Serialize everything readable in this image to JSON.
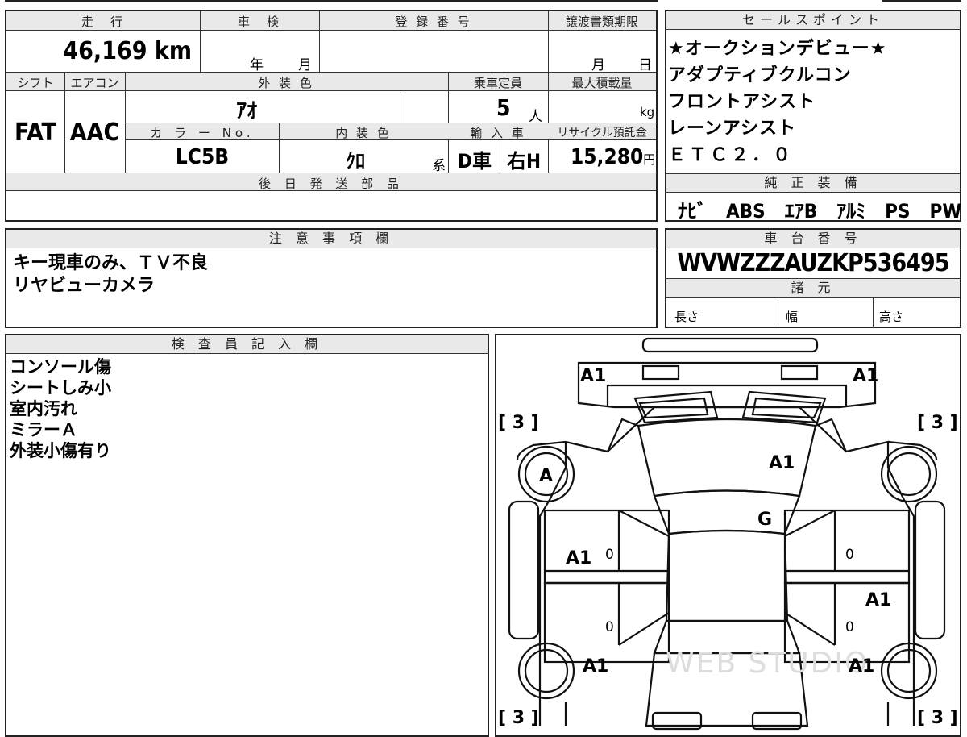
{
  "sheet": {
    "mileage": {
      "label": "走　行",
      "value": "46,169",
      "unit": "km"
    },
    "inspection": {
      "label": "車　検",
      "year_label": "年",
      "month_label": "月"
    },
    "registration": {
      "label": "登 録 番 号"
    },
    "transfer_deadline": {
      "label": "譲渡書類期限",
      "month_label": "月",
      "day_label": "日"
    },
    "shift": {
      "label": "シフト",
      "value": "FAT"
    },
    "aircon": {
      "label": "エアコン",
      "value": "AAC"
    },
    "exterior_color": {
      "label": "外 装 色",
      "value": "ｱｵ"
    },
    "capacity": {
      "label": "乗車定員",
      "value": "5",
      "unit": "人"
    },
    "max_load": {
      "label": "最大積載量",
      "unit": "kg"
    },
    "color_no": {
      "label": "カ ラ ー No.",
      "value": "LC5B"
    },
    "interior_color": {
      "label": "内 装 色",
      "value": "ｸﾛ",
      "suffix": "系"
    },
    "import": {
      "label": "輸 入 車",
      "value1": "D車",
      "value2": "右H"
    },
    "recycle": {
      "label": "リサイクル預託金",
      "value": "15,280",
      "unit": "円"
    },
    "later_parts": {
      "label": "後 日 発 送 部 品"
    }
  },
  "sales_points": {
    "label": "セールスポイント",
    "lines": [
      "★オークションデビュー★",
      "アダプティブクルコン",
      "フロントアシスト",
      "レーンアシスト",
      "ＥＴＣ２．０"
    ]
  },
  "genuine_equipment": {
    "label": "純 正 装 備",
    "value": "ﾅﾋﾞ　ABS　ｴｱB　ｱﾙﾐ　PS　PW"
  },
  "caution": {
    "label": "注 意 事 項 欄",
    "lines": [
      "キー現車のみ、ＴＶ不良",
      "リヤビューカメラ"
    ]
  },
  "chassis": {
    "label": "車 台 番 号",
    "value": "WVWZZZAUZKP536495"
  },
  "specs": {
    "label": "諸 元",
    "length_label": "長さ",
    "width_label": "幅",
    "height_label": "高さ"
  },
  "inspector": {
    "label": "検 査 員 記 入 欄",
    "lines": [
      "コンソール傷",
      "シートしみ小",
      "室内汚れ",
      "ミラーＡ",
      "外装小傷有り"
    ]
  },
  "diagram": {
    "marks": {
      "front_left": "A1",
      "front_right": "A1",
      "bracket_tl": "[ 3 ]",
      "bracket_tr": "[ 3 ]",
      "bracket_bl": "[ 3 ]",
      "bracket_br": "[ 3 ]",
      "wheel_fl": "A",
      "hood": "A1",
      "windshield": "G",
      "door_fl": "A1",
      "door_rr": "A1",
      "wheel_rl": "A1",
      "wheel_rr": "A1",
      "zero_a": "0",
      "zero_b": "0",
      "zero_c": "0",
      "zero_d": "0"
    },
    "watermark": "WEB STUDIO"
  }
}
